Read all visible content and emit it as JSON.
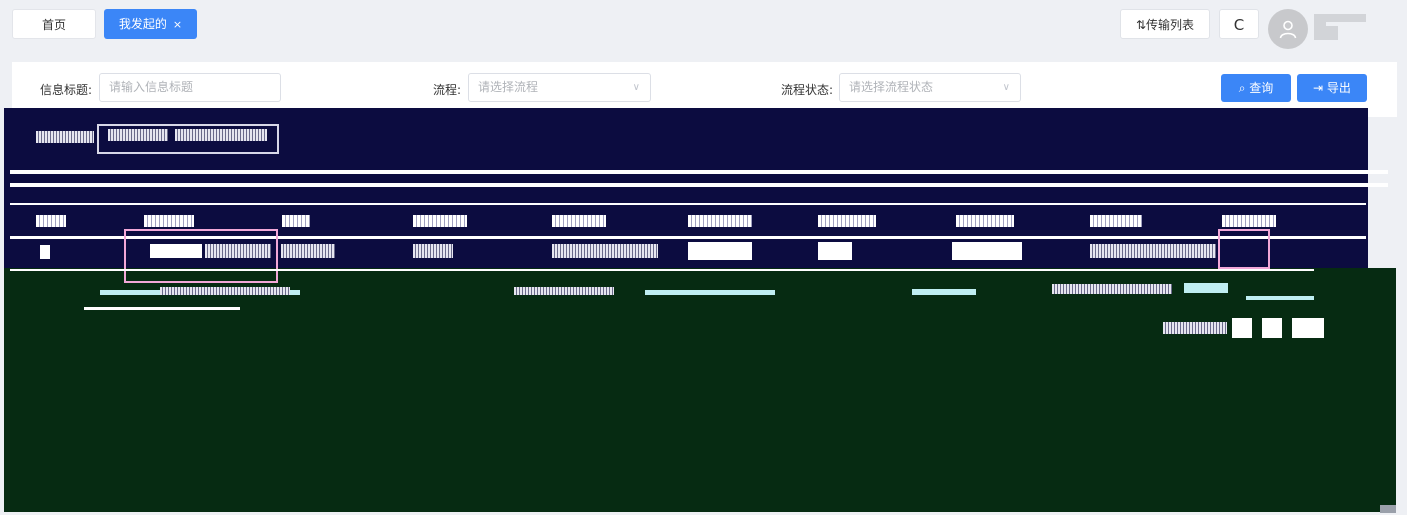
{
  "tabs": {
    "home_label": "首页",
    "active_label": "我发起的",
    "close_glyph": "×"
  },
  "header": {
    "transfer_label": "传输列表",
    "transfer_icon": "sort-arrows-icon",
    "refresh_glyph": "C",
    "avatar_icon": "user-icon"
  },
  "search": {
    "title_label": "信息标题:",
    "title_placeholder": "请输入信息标题",
    "process_label": "流程:",
    "process_placeholder": "请选择流程",
    "status_label": "流程状态:",
    "status_placeholder": "请选择流程状态",
    "query_label": "查询",
    "export_label": "导出"
  },
  "colors": {
    "primary": "#3b86f7",
    "background": "#eef0f4",
    "glitch_navy": "#0c0c40",
    "glitch_green": "#062b12"
  }
}
